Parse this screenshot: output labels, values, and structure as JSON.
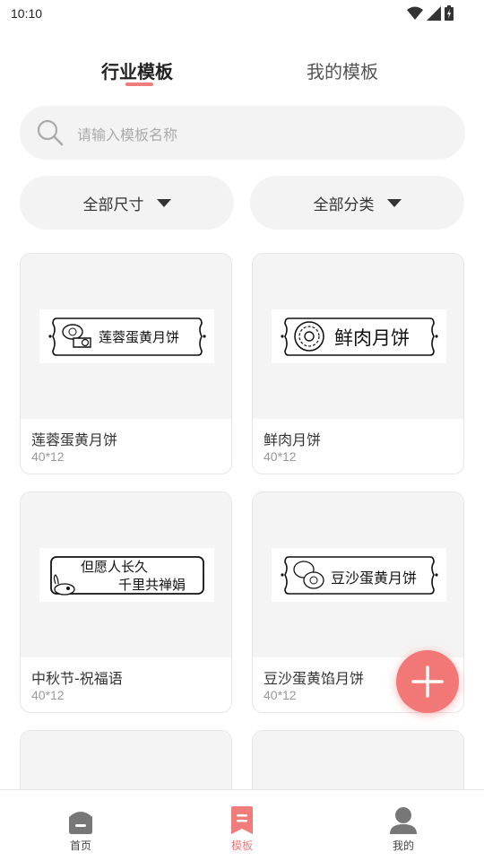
{
  "status": {
    "time": "10:10"
  },
  "tabs": {
    "industry": "行业模板",
    "mine": "我的模板"
  },
  "search": {
    "placeholder": "请输入模板名称"
  },
  "filters": {
    "size": "全部尺寸",
    "category": "全部分类"
  },
  "cards": [
    {
      "title": "莲蓉蛋黄月饼",
      "size": "40*12",
      "label_text": "莲蓉蛋黄月饼"
    },
    {
      "title": "鲜肉月饼",
      "size": "40*12",
      "label_text": "鲜肉月饼"
    },
    {
      "title": "中秋节-祝福语",
      "size": "40*12",
      "label_line1": "但愿人长久",
      "label_line2": "千里共禅娟"
    },
    {
      "title": "豆沙蛋黄馅月饼",
      "size": "40*12",
      "label_text": "豆沙蛋黄月饼"
    }
  ],
  "nav": {
    "home": "首页",
    "templates": "模板",
    "mine": "我的"
  },
  "colors": {
    "accent": "#f07c7c",
    "background": "#ffffff",
    "surface": "#f3f3f3"
  }
}
